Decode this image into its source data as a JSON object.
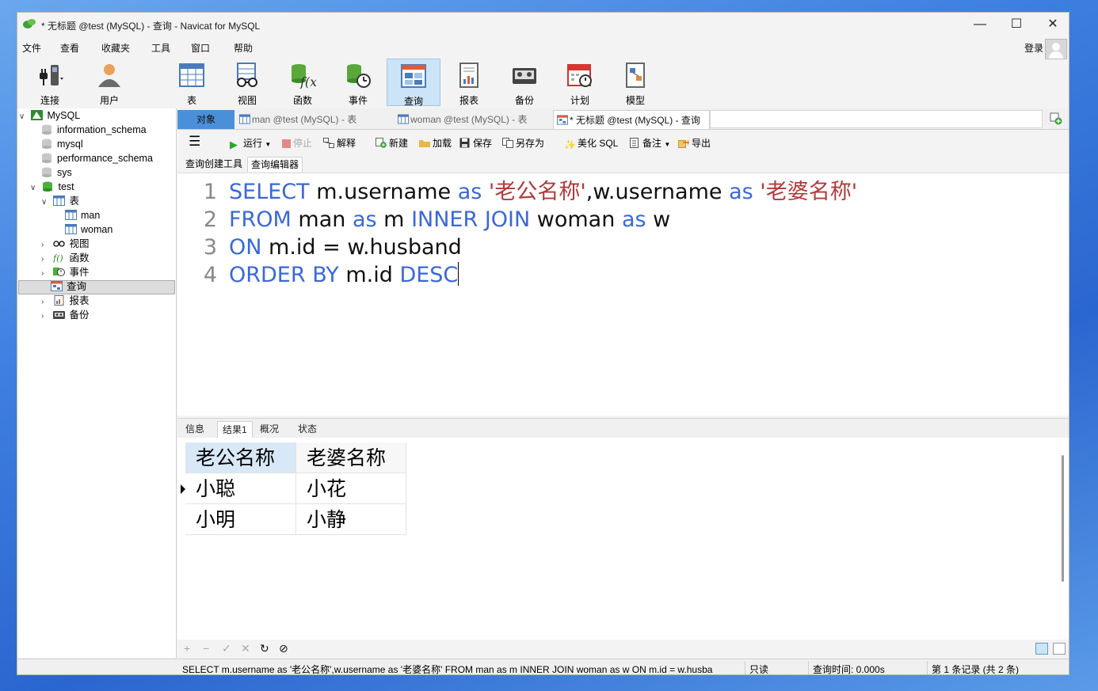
{
  "window": {
    "title": "* 无标题 @test (MySQL) - 查询 - Navicat for MySQL",
    "controls": {
      "minimize": "—",
      "maximize": "☐",
      "close": "✕"
    }
  },
  "menu": [
    "文件",
    "查看",
    "收藏夹",
    "工具",
    "窗口",
    "帮助"
  ],
  "login": "登录",
  "toolbar": [
    {
      "label": "连接",
      "icon": "connect-plug-icon"
    },
    {
      "label": "用户",
      "icon": "user-icon"
    },
    {
      "label": "表",
      "icon": "table-icon"
    },
    {
      "label": "视图",
      "icon": "view-glasses-icon"
    },
    {
      "label": "函数",
      "icon": "function-icon"
    },
    {
      "label": "事件",
      "icon": "event-clock-icon"
    },
    {
      "label": "查询",
      "icon": "query-icon",
      "active": true
    },
    {
      "label": "报表",
      "icon": "report-icon"
    },
    {
      "label": "备份",
      "icon": "backup-icon"
    },
    {
      "label": "计划",
      "icon": "schedule-icon"
    },
    {
      "label": "模型",
      "icon": "model-icon"
    }
  ],
  "tree": {
    "connection": "MySQL",
    "databases": [
      "information_schema",
      "mysql",
      "performance_schema",
      "sys",
      "test"
    ],
    "test_children": {
      "tables_label": "表",
      "tables": [
        "man",
        "woman"
      ],
      "views": "视图",
      "functions": "函数",
      "events": "事件",
      "queries": "查询",
      "reports": "报表",
      "backups": "备份"
    }
  },
  "tabs": [
    {
      "label": "对象"
    },
    {
      "label": "man @test (MySQL) - 表"
    },
    {
      "label": "woman @test (MySQL) - 表"
    },
    {
      "label": "* 无标题 @test (MySQL) - 查询"
    }
  ],
  "query_toolbar": {
    "run": "运行",
    "stop": "停止",
    "explain": "解释",
    "new": "新建",
    "load": "加载",
    "save": "保存",
    "save_as": "另存为",
    "beautify": "美化 SQL",
    "note": "备注",
    "export": "导出"
  },
  "editor_tabs": [
    "查询创建工具",
    "查询编辑器"
  ],
  "sql_lines": [
    {
      "num": "1",
      "parts": [
        [
          "kw",
          "SELECT "
        ],
        [
          "id",
          "m.username "
        ],
        [
          "kw",
          "as "
        ],
        [
          "str",
          "'老公名称'"
        ],
        [
          "id",
          ",w.username "
        ],
        [
          "kw",
          "as "
        ],
        [
          "str",
          "'老婆名称'"
        ]
      ]
    },
    {
      "num": "2",
      "parts": [
        [
          "kw",
          "FROM "
        ],
        [
          "id",
          "man "
        ],
        [
          "kw",
          "as "
        ],
        [
          "id",
          "m "
        ],
        [
          "kw",
          "INNER JOIN "
        ],
        [
          "id",
          "woman "
        ],
        [
          "kw",
          "as "
        ],
        [
          "id",
          "w"
        ]
      ]
    },
    {
      "num": "3",
      "parts": [
        [
          "kw",
          "ON "
        ],
        [
          "id",
          "m.id = w.husband"
        ]
      ]
    },
    {
      "num": "4",
      "parts": [
        [
          "kw",
          "ORDER BY "
        ],
        [
          "id",
          "m.id "
        ],
        [
          "kw",
          "DESC"
        ]
      ]
    }
  ],
  "result_tabs": [
    "信息",
    "结果1",
    "概况",
    "状态"
  ],
  "result_grid": {
    "columns": [
      "老公名称",
      "老婆名称"
    ],
    "rows": [
      [
        "小聪",
        "小花"
      ],
      [
        "小明",
        "小静"
      ]
    ]
  },
  "grid_toolbar": [
    "+",
    "−",
    "✓",
    "✕",
    "↻",
    "⊘"
  ],
  "status": {
    "sql": "SELECT m.username as '老公名称',w.username as '老婆名称' FROM man as m INNER JOIN woman as w ON m.id = w.husba",
    "mode": "只读",
    "time": "查询时间: 0.000s",
    "records": "第 1 条记录 (共 2 条)"
  }
}
